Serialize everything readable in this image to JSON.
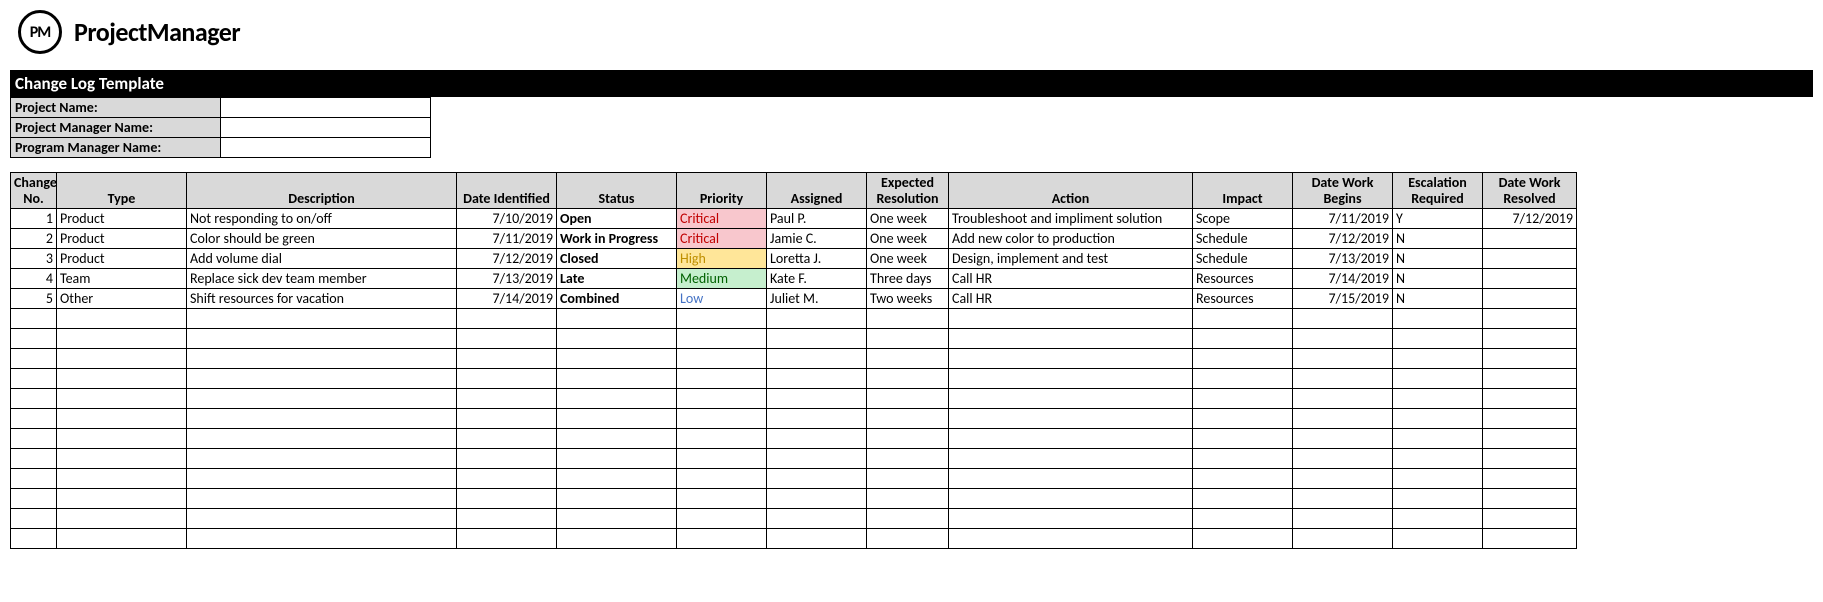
{
  "brand": {
    "logo_text": "PM",
    "name": "ProjectManager"
  },
  "title": "Change Log Template",
  "meta": {
    "project_name_label": "Project Name:",
    "project_name_value": "",
    "project_manager_label": "Project Manager Name:",
    "project_manager_value": "",
    "program_manager_label": "Program Manager Name:",
    "program_manager_value": ""
  },
  "columns": {
    "no": "Change No.",
    "type": "Type",
    "description": "Description",
    "date_identified": "Date Identified",
    "status": "Status",
    "priority": "Priority",
    "assigned": "Assigned",
    "expected_resolution": "Expected Resolution",
    "action": "Action",
    "impact": "Impact",
    "date_work_begins": "Date Work Begins",
    "escalation_required": "Escalation Required",
    "date_work_resolved": "Date Work Resolved"
  },
  "rows": [
    {
      "no": "1",
      "type": "Product",
      "description": "Not responding to on/off",
      "date_identified": "7/10/2019",
      "status": "Open",
      "priority": "Critical",
      "priority_class": "prio-critical",
      "assigned": "Paul P.",
      "expected_resolution": "One week",
      "action": "Troubleshoot and impliment solution",
      "impact": "Scope",
      "date_work_begins": "7/11/2019",
      "escalation_required": "Y",
      "date_work_resolved": "7/12/2019"
    },
    {
      "no": "2",
      "type": "Product",
      "description": "Color should be green",
      "date_identified": "7/11/2019",
      "status": "Work in Progress",
      "priority": "Critical",
      "priority_class": "prio-critical",
      "assigned": "Jamie C.",
      "expected_resolution": "One week",
      "action": "Add new color to production",
      "impact": "Schedule",
      "date_work_begins": "7/12/2019",
      "escalation_required": "N",
      "date_work_resolved": ""
    },
    {
      "no": "3",
      "type": "Product",
      "description": "Add volume dial",
      "date_identified": "7/12/2019",
      "status": "Closed",
      "priority": "High",
      "priority_class": "prio-high",
      "assigned": "Loretta J.",
      "expected_resolution": "One week",
      "action": "Design, implement and test",
      "impact": "Schedule",
      "date_work_begins": "7/13/2019",
      "escalation_required": "N",
      "date_work_resolved": ""
    },
    {
      "no": "4",
      "type": "Team",
      "description": "Replace sick dev team member",
      "date_identified": "7/13/2019",
      "status": "Late",
      "priority": "Medium",
      "priority_class": "prio-medium",
      "assigned": "Kate F.",
      "expected_resolution": "Three days",
      "action": "Call HR",
      "impact": "Resources",
      "date_work_begins": "7/14/2019",
      "escalation_required": "N",
      "date_work_resolved": ""
    },
    {
      "no": "5",
      "type": "Other",
      "description": "Shift resources for vacation",
      "date_identified": "7/14/2019",
      "status": "Combined",
      "priority": "Low",
      "priority_class": "prio-low",
      "assigned": "Juliet M.",
      "expected_resolution": "Two weeks",
      "action": "Call HR",
      "impact": "Resources",
      "date_work_begins": "7/15/2019",
      "escalation_required": "N",
      "date_work_resolved": ""
    }
  ],
  "empty_rows": 12
}
